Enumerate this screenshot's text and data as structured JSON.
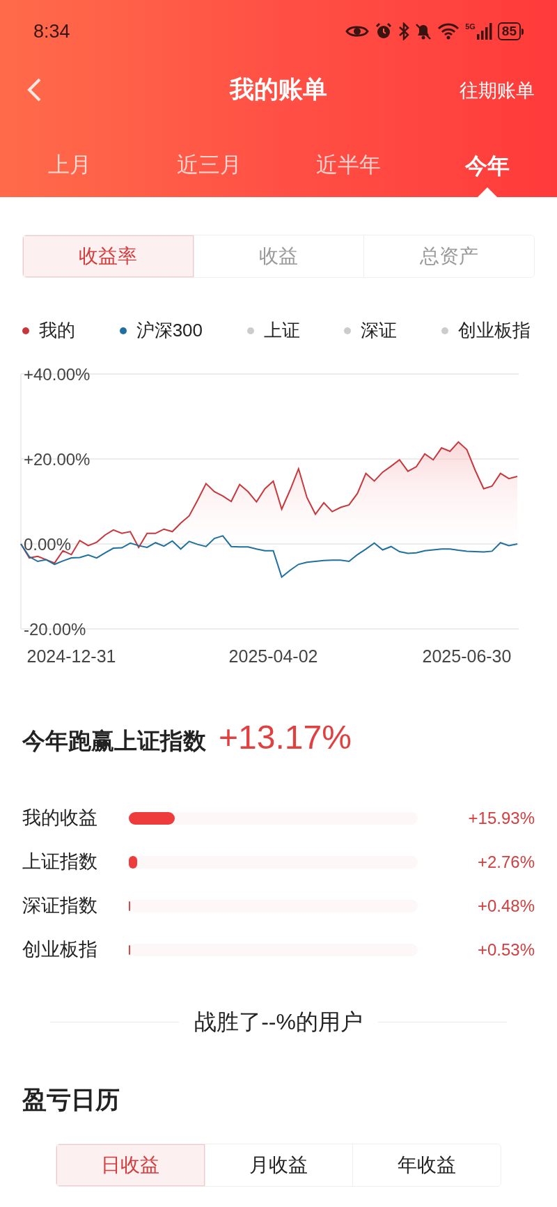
{
  "status_bar": {
    "time": "8:34",
    "network": "5G",
    "battery": "85"
  },
  "nav": {
    "title": "我的账单",
    "action": "往期账单"
  },
  "period_tabs": [
    {
      "label": "上月",
      "selected": false
    },
    {
      "label": "近三月",
      "selected": false
    },
    {
      "label": "近半年",
      "selected": false
    },
    {
      "label": "今年",
      "selected": true
    }
  ],
  "metric_tabs": [
    {
      "label": "收益率",
      "selected": true
    },
    {
      "label": "收益",
      "selected": false
    },
    {
      "label": "总资产",
      "selected": false
    }
  ],
  "legend": [
    {
      "label": "上证",
      "color": "#cccccc"
    },
    {
      "label": "深证",
      "color": "#cccccc"
    },
    {
      "label": "创业板指",
      "color": "#cccccc"
    }
  ],
  "chart_data": {
    "type": "area",
    "categories": [
      null,
      null,
      null,
      null,
      null,
      null,
      "2024-12-31",
      null,
      null,
      null,
      null,
      null,
      null,
      null,
      null,
      null,
      null,
      null,
      null,
      null,
      null,
      null,
      null,
      null,
      null,
      null,
      null,
      null,
      null,
      null,
      "2025-04-02",
      null,
      null,
      null,
      null,
      null,
      null,
      null,
      null,
      null,
      null,
      null,
      null,
      null,
      null,
      null,
      null,
      null,
      null,
      null,
      null,
      null,
      null,
      "2025-06-30",
      null,
      null,
      null,
      null,
      null,
      null
    ],
    "series": [
      {
        "name": "我的",
        "color": "#c8373c",
        "values": [
          0,
          -3.3,
          -2.9,
          -3.7,
          -4.5,
          -1.6,
          -2.5,
          0.8,
          -0.4,
          0.4,
          2.1,
          3.3,
          2.5,
          2.9,
          -0.8,
          2.5,
          2.5,
          3.5,
          2.9,
          4.9,
          6.6,
          10.3,
          14.2,
          12.3,
          11.3,
          10.0,
          14.0,
          12.3,
          9.9,
          13.0,
          14.8,
          8.2,
          12.7,
          17.7,
          10.9,
          7.0,
          9.7,
          7.6,
          8.6,
          9.2,
          11.9,
          16.6,
          14.8,
          16.9,
          18.3,
          19.8,
          17.1,
          18.2,
          21.2,
          19.8,
          22.6,
          21.8,
          24.0,
          22.2,
          17.3,
          13.0,
          13.6,
          16.6,
          15.4,
          15.9
        ]
      },
      {
        "name": "沪深300",
        "type": "line",
        "color": "#1f6f9f",
        "values": [
          0,
          -3.0,
          -4.1,
          -3.7,
          -4.8,
          -4.0,
          -3.3,
          -3.2,
          -2.6,
          -3.3,
          -2.1,
          -1.0,
          -0.9,
          0.2,
          -0.4,
          -0.8,
          0.3,
          -0.5,
          0.7,
          -1.2,
          0.6,
          -0.1,
          -0.6,
          1.3,
          1.9,
          -0.6,
          -0.7,
          -0.7,
          -1.2,
          -1.6,
          -1.6,
          -7.8,
          -6.2,
          -4.8,
          -4.3,
          -4.1,
          -3.9,
          -3.8,
          -3.8,
          -4.1,
          -2.5,
          -1.2,
          0.2,
          -1.4,
          -0.6,
          -1.8,
          -2.2,
          -2.1,
          -1.6,
          -1.4,
          -1.2,
          -1.2,
          -1.5,
          -1.7,
          -1.8,
          -1.9,
          -1.7,
          0.3,
          -0.4,
          0
        ]
      }
    ],
    "ylim": [
      -20,
      40
    ],
    "yticks": [
      {
        "value": 40,
        "label": "+40.00%"
      },
      {
        "value": 20,
        "label": "+20.00%"
      },
      {
        "value": 0,
        "label": "0.00%"
      },
      {
        "value": -20,
        "label": "-20.00%"
      }
    ]
  },
  "summary": {
    "label": "今年跑赢上证指数",
    "value": "+13.17%"
  },
  "comparison": [
    {
      "label": "我的收益",
      "level": 0.16,
      "value": "+15.93%"
    },
    {
      "label": "上证指数",
      "level": 0.028,
      "value": "+2.76%"
    },
    {
      "label": "深证指数",
      "level": 0.005,
      "value": "+0.48%"
    },
    {
      "label": "创业板指",
      "level": 0.005,
      "value": "+0.53%"
    }
  ],
  "rank_text": "战胜了--%的用户",
  "calendar": {
    "title": "盈亏日历",
    "tabs": [
      {
        "label": "日收益",
        "selected": true
      },
      {
        "label": "月收益",
        "selected": false
      },
      {
        "label": "年收益",
        "selected": false
      }
    ]
  }
}
